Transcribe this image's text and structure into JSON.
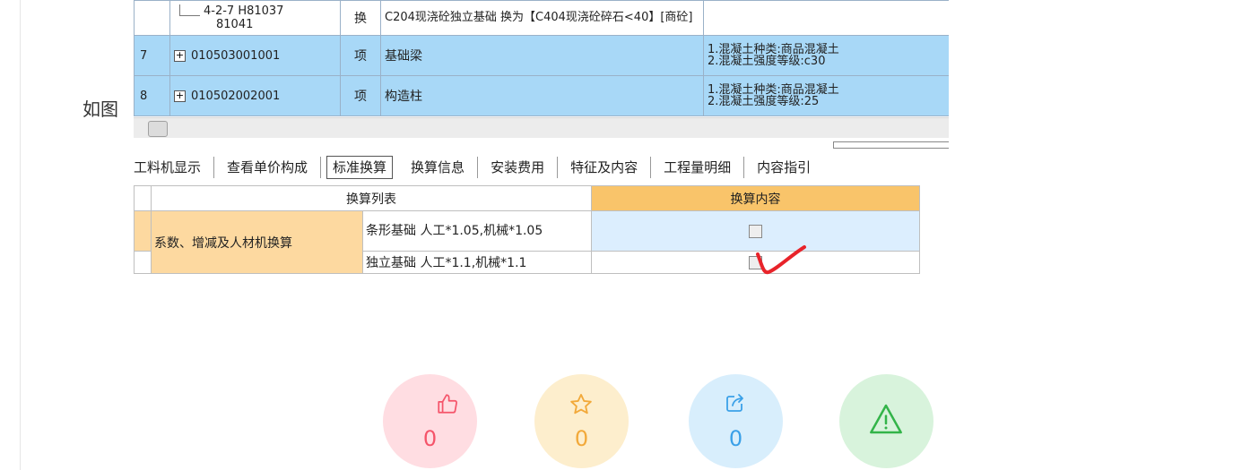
{
  "caption": "如图",
  "grid": {
    "sub_row": {
      "code_line1": "4-2-7 H81037",
      "code_line2": "81041",
      "type": "换",
      "name": "C204现浇砼独立基础 换为【C404现浇砼碎石<40】[商砼]"
    },
    "rows": [
      {
        "num": "7",
        "code": "010503001001",
        "unit": "项",
        "name": "基础梁",
        "feature1": "1.混凝土种类:商品混凝土",
        "feature2": "2.混凝土强度等级:c30"
      },
      {
        "num": "8",
        "code": "010502002001",
        "unit": "项",
        "name": "构造柱",
        "feature1": "1.混凝土种类:商品混凝土",
        "feature2": "2.混凝土强度等级:25"
      }
    ]
  },
  "tabs": [
    "工料机显示",
    "查看单价构成",
    "标准换算",
    "换算信息",
    "安装费用",
    "特征及内容",
    "工程量明细",
    "内容指引"
  ],
  "active_tab": "标准换算",
  "conversion": {
    "list_header": "换算列表",
    "content_header": "换算内容",
    "category": "系数、增减及人材机换算",
    "items": [
      {
        "label": "条形基础 人工*1.05,机械*1.05",
        "checked": false
      },
      {
        "label": "独立基础 人工*1.1,机械*1.1",
        "checked": false
      }
    ]
  },
  "actions": {
    "like": {
      "icon": "thumbs-up-icon",
      "count": "0"
    },
    "favorite": {
      "icon": "star-icon",
      "count": "0"
    },
    "share": {
      "icon": "share-icon",
      "count": "0"
    },
    "report": {
      "icon": "warning-icon"
    }
  },
  "colors": {
    "row_highlight": "#a8d8f7",
    "content_header": "#f9c46a",
    "category_cell": "#fdd9a0",
    "annotation_tick": "#e8232a",
    "like": "#f5546a",
    "favorite": "#f2a93a",
    "share": "#3aa0e8",
    "report": "#33b449"
  }
}
